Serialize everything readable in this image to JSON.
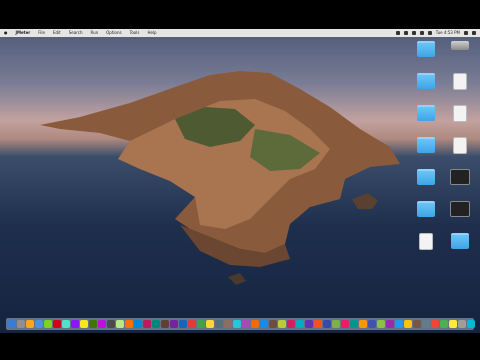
{
  "menubar": {
    "apple": "",
    "app_name": "JMeter",
    "menus": [
      "File",
      "Edit",
      "Search",
      "Run",
      "Options",
      "Tools",
      "Help"
    ],
    "clock": "Tue 4:53 PM"
  },
  "desktop_icons": [
    {
      "label": "",
      "kind": "folder",
      "icon": "folder-icon"
    },
    {
      "label": "",
      "kind": "drive",
      "icon": "drive-icon"
    },
    {
      "label": "",
      "kind": "folder",
      "icon": "folder-icon"
    },
    {
      "label": "",
      "kind": "doc",
      "icon": "document-icon"
    },
    {
      "label": "",
      "kind": "folder",
      "icon": "folder-icon"
    },
    {
      "label": "",
      "kind": "doc",
      "icon": "document-icon"
    },
    {
      "label": "",
      "kind": "folder",
      "icon": "folder-icon"
    },
    {
      "label": "",
      "kind": "doc",
      "icon": "document-icon"
    },
    {
      "label": "",
      "kind": "folder",
      "icon": "folder-icon"
    },
    {
      "label": "",
      "kind": "dark",
      "icon": "terminal-icon"
    },
    {
      "label": "",
      "kind": "folder",
      "icon": "folder-icon"
    },
    {
      "label": "",
      "kind": "dark",
      "icon": "app-icon"
    },
    {
      "label": "",
      "kind": "doc",
      "icon": "document-icon"
    },
    {
      "label": "",
      "kind": "folder",
      "icon": "folder-icon"
    }
  ],
  "dock_colors": [
    "#3a7bd5",
    "#8e8e93",
    "#f5a623",
    "#4a90e2",
    "#7ed321",
    "#d0021b",
    "#50e3c2",
    "#9013fe",
    "#f8e71c",
    "#417505",
    "#bd10e0",
    "#4a4a4a",
    "#b8e986",
    "#ff6f00",
    "#0288d1",
    "#c2185b",
    "#00897b",
    "#5d4037",
    "#7b1fa2",
    "#1565c0",
    "#e53935",
    "#43a047",
    "#fdd835",
    "#546e7a",
    "#8d6e63",
    "#26c6da",
    "#ab47bc",
    "#ef6c00",
    "#1e88e5",
    "#6d4c41",
    "#c0ca33",
    "#d81b60",
    "#00acc1",
    "#5e35b1",
    "#f4511e",
    "#3949ab",
    "#7cb342",
    "#e91e63",
    "#009688",
    "#ff9800",
    "#3f51b5",
    "#8bc34a",
    "#9c27b0",
    "#2196f3",
    "#ffc107",
    "#795548",
    "#607d8b",
    "#f44336",
    "#4caf50",
    "#ffeb3b",
    "#9e9e9e",
    "#00bcd4"
  ]
}
